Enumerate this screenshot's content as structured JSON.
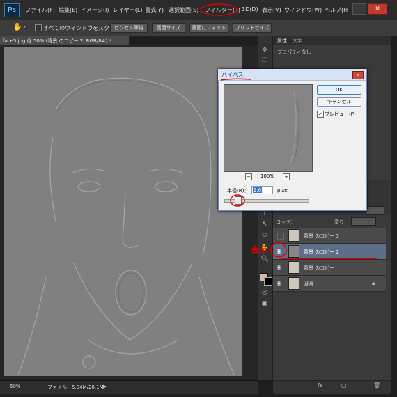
{
  "menubar": {
    "logo": "Ps",
    "items": [
      "ファイル(F)",
      "編集(E)",
      "イメージ(I)",
      "レイヤー(L)",
      "書式(Y)",
      "選択範囲(S)",
      "フィルター(T)",
      "3D(D)",
      "表示(V)",
      "ウィンドウ(W)",
      "ヘルプ(H"
    ]
  },
  "options": {
    "scroll_all_label": "すべてのウィンドウをスクロール",
    "buttons": [
      "ピクセル等倍",
      "画面サイズ",
      "画面にフィット",
      "プリントサイズ"
    ]
  },
  "document": {
    "tab_title": "face5.jpg @ 50% (背景 のコピー 2, RGB/8#) *"
  },
  "status": {
    "zoom": "50%",
    "file_info": "ファイル：5.04M/20.1M"
  },
  "panels": {
    "tab_properties": "属性",
    "tab_character": "文字",
    "properties_empty": "プロパティなし",
    "lock_label": "ロック：",
    "fill_label": "塗り："
  },
  "layers": [
    {
      "name": "背景 のコピー 3",
      "visible": false
    },
    {
      "name": "背景 のコピー 2",
      "visible": true,
      "selected": true
    },
    {
      "name": "背景 のコピー",
      "visible": true
    },
    {
      "name": "背景",
      "visible": true,
      "locked": true
    }
  ],
  "annotation": {
    "label": "表示",
    "color": "#e00000"
  },
  "dialog": {
    "title": "ハイパス",
    "ok": "OK",
    "cancel": "キャンセル",
    "preview_label": "プレビュー(P)",
    "preview_checked": true,
    "zoom": "100%",
    "radius_label": "半径(R)：",
    "radius_value": "2.6",
    "radius_unit": "pixel"
  },
  "colors": {
    "accent_red": "#e00000",
    "dialog_title_text": "#1a3f9a"
  }
}
